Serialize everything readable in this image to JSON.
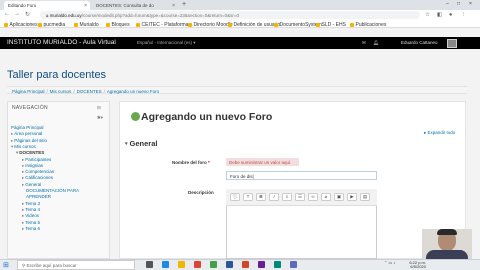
{
  "browser": {
    "tabs": [
      {
        "label": "Editando Foro",
        "active": true
      },
      {
        "label": "DOCENTES: Consulta de documen...",
        "active": false
      }
    ],
    "url_host": "murialdo.edu.uy",
    "url_path": "/course/modedit.php?add=forum&type=&course=23&section=0&return=0&sr=0",
    "bookmarks": [
      "Aplicaciones",
      "pucmedia",
      "Murialdo",
      "Bloques",
      "CEITEC - Plataforma...",
      "Directorio Moodle",
      "Definición de usuario",
      "DocumentoSystem",
      "SLD - EHS",
      "Publicaciones"
    ]
  },
  "navbar": {
    "brand": "INSTITUTO MURIALDO - Aula Virtual",
    "language": "Español - Internacional (es) ▾",
    "user_name": "Eduardo Cattaneo"
  },
  "page": {
    "title": "Taller para docentes",
    "breadcrumb": [
      "Página Principal",
      "Mis cursos",
      "DOCENTES",
      "Agregando un nuevo Foro"
    ]
  },
  "sidebar": {
    "heading": "NAVEGACIÓN",
    "items": [
      {
        "label": "Página Principal",
        "level": 0,
        "icon": ""
      },
      {
        "label": "Área personal",
        "level": 0,
        "icon": "▸"
      },
      {
        "label": "Páginas del sitio",
        "level": 0,
        "icon": "▸"
      },
      {
        "label": "Mis cursos",
        "level": 0,
        "icon": "▾"
      },
      {
        "label": "DOCENTES",
        "level": 1,
        "icon": "▾",
        "bold": true
      },
      {
        "label": "Participantes",
        "level": 2,
        "icon": "▸"
      },
      {
        "label": "Insignias",
        "level": 2,
        "icon": "▸"
      },
      {
        "label": "Competencias",
        "level": 2,
        "icon": "▸"
      },
      {
        "label": "Calificaciones",
        "level": 2,
        "icon": "▸"
      },
      {
        "label": "General",
        "level": 2,
        "icon": "▸"
      },
      {
        "label": "DOCUMENTACIÓN PARA",
        "level": 3,
        "icon": ""
      },
      {
        "label": "APRENDER",
        "level": 3,
        "icon": ""
      },
      {
        "label": "Tema 3",
        "level": 2,
        "icon": "▸"
      },
      {
        "label": "Tema 4",
        "level": 2,
        "icon": "▸"
      },
      {
        "label": "Videos",
        "level": 2,
        "icon": "▸"
      },
      {
        "label": "Tema 5",
        "level": 2,
        "icon": "▸"
      },
      {
        "label": "Tema 6",
        "level": 2,
        "icon": "▸"
      }
    ]
  },
  "form": {
    "heading": "Agregando un nuevo Foro",
    "expand_all": "Expandir todo",
    "section": "General",
    "name_label": "Nombre del foro",
    "required_mark": "*",
    "error": "Debe suministrar un valor aquí.",
    "name_value": "Foro de dis",
    "description_label": "Descripción",
    "toolbar_icons": [
      "info-icon",
      "font-size-icon",
      "bold-icon",
      "italic-icon",
      "bullet-list-icon",
      "numbered-list-icon",
      "link-icon",
      "unlink-icon",
      "image-icon",
      "media-icon",
      "file-icon"
    ]
  },
  "taskbar": {
    "search_placeholder": "Escribe aquí para buscar",
    "time": "6:22 p.m.",
    "date": "6/5/2020"
  }
}
